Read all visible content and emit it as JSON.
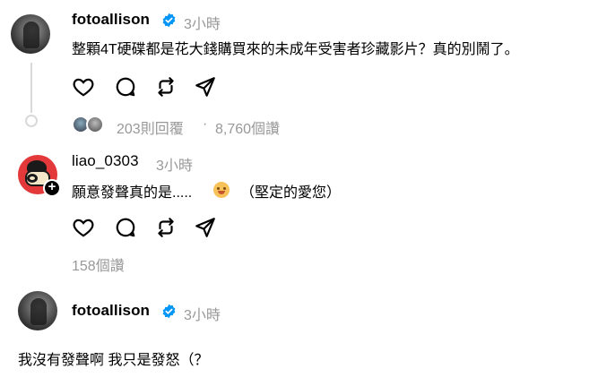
{
  "post1": {
    "username": "fotoallison",
    "time": "3小時",
    "text": "整顆4T硬碟都是花大錢購買來的未成年受害者珍藏影片？真的別鬧了。",
    "replies": "203則回覆",
    "separator": "·",
    "views": "8,760個讚"
  },
  "post2": {
    "username": "liao_0303",
    "time": "3小時",
    "text_before": "願意發聲真的是.....",
    "text_after": "（堅定的愛您）",
    "views": "158個讚"
  },
  "post3": {
    "username": "fotoallison",
    "time": "3小時",
    "text": "我沒有發聲啊 我只是發怒（？"
  },
  "icons": {
    "like": "heart-icon",
    "comment": "comment-bubble-icon",
    "repost": "repost-icon",
    "share": "send-icon",
    "verified": "verified-badge-icon",
    "follow": "plus-icon"
  },
  "colors": {
    "verified": "#0095f6",
    "muted": "#999999",
    "line": "#d9d9d9"
  }
}
